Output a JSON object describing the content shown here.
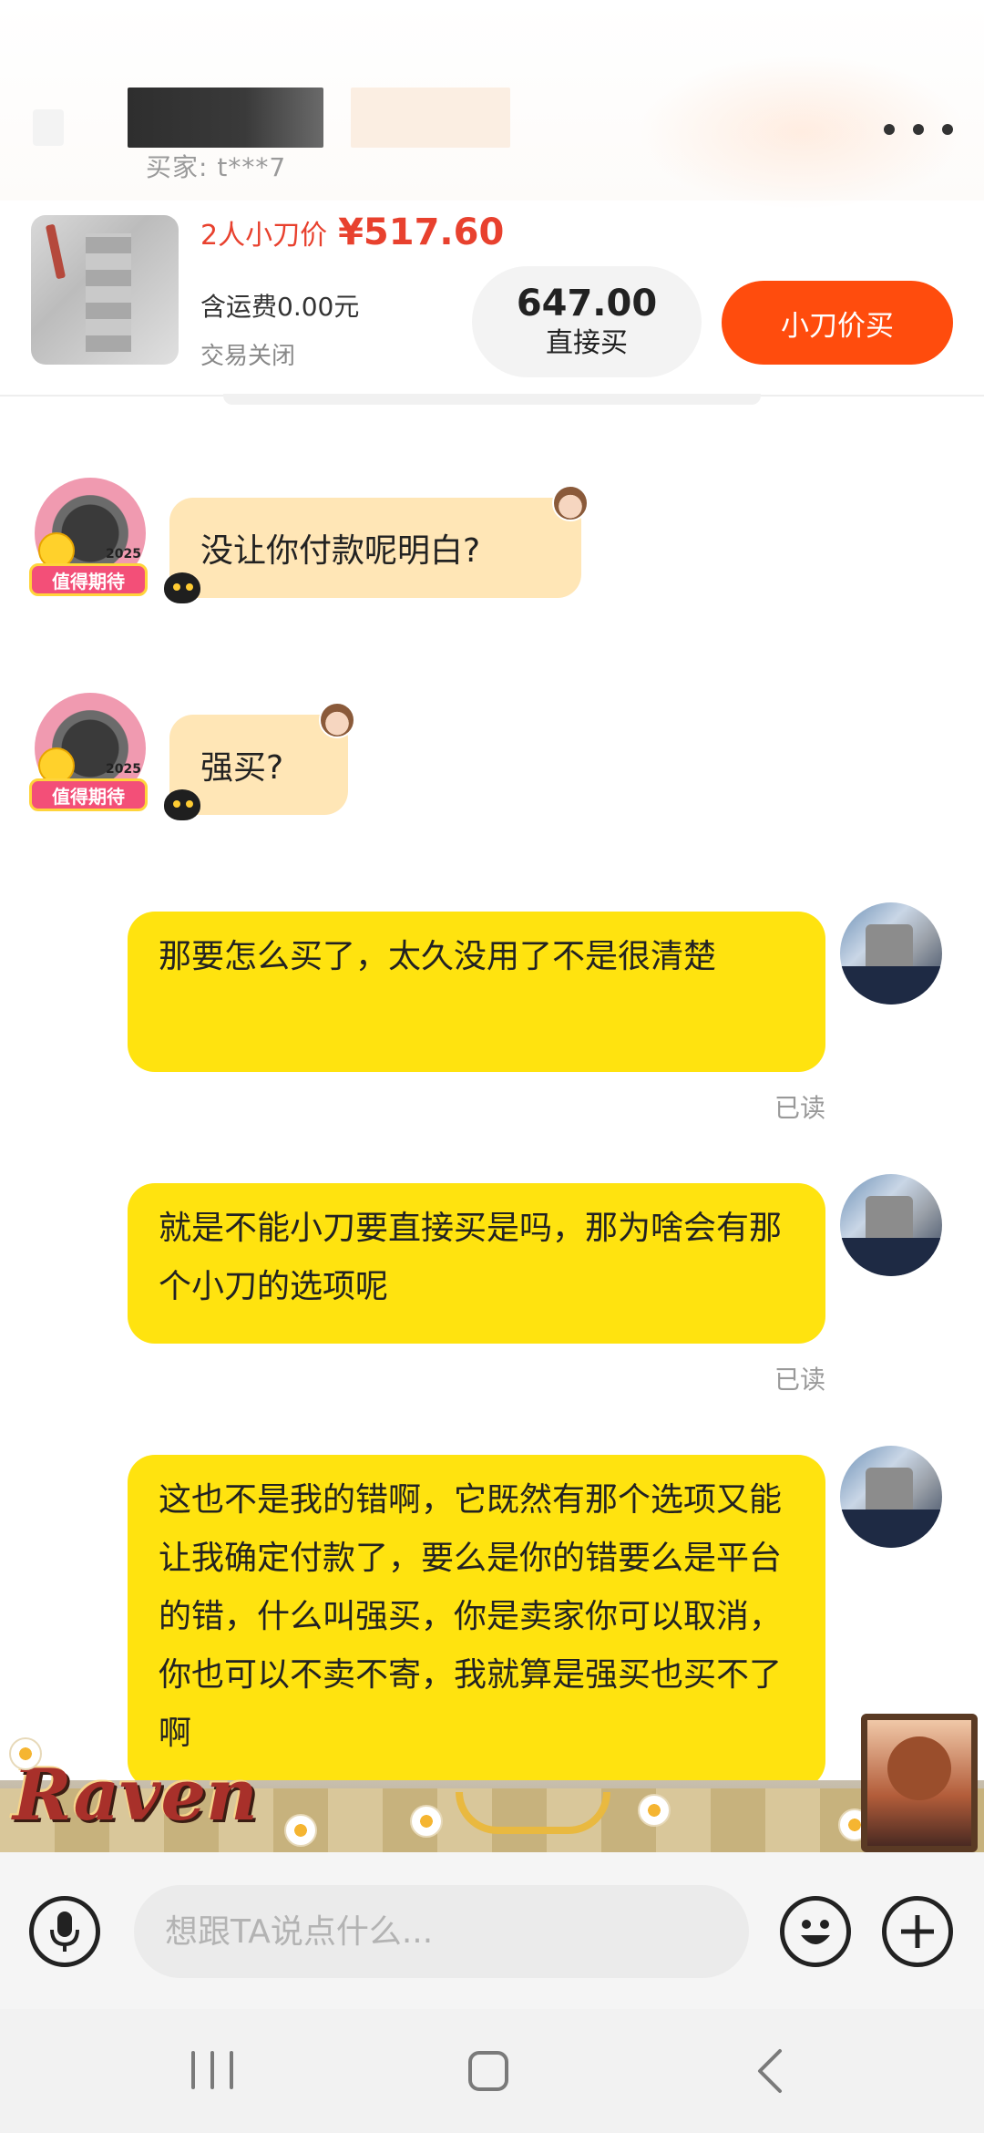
{
  "header": {
    "buyer_label": "买家: t***7",
    "more_icon": "more-dots-icon"
  },
  "product": {
    "price_tag": "2人小刀价",
    "price_value": "¥517.60",
    "shipping": "含运费0.00元",
    "status": "交易关闭",
    "direct_price": "647.00",
    "direct_label": "直接买",
    "cut_button": "小刀价买"
  },
  "messages": [
    {
      "from": "seller",
      "text": "没让你付款呢明白?"
    },
    {
      "from": "seller",
      "text": "强买?"
    },
    {
      "from": "self",
      "text": "那要怎么买了，太久没用了不是很清楚",
      "status": "已读"
    },
    {
      "from": "self",
      "text": "就是不能小刀要直接买是吗，那为啥会有那个小刀的选项呢",
      "status": "已读"
    },
    {
      "from": "self",
      "text": "这也不是我的错啊，它既然有那个选项又能让我确定付款了，要么是你的错要么是平台的错，什么叫强买，你是卖家你可以取消，你也可以不卖不寄，我就算是强买也买不了啊"
    }
  ],
  "seller_avatar_badge": "值得期待",
  "seller_avatar_year": "2025",
  "banner_text": "Raven",
  "input": {
    "placeholder": "想跟TA说点什么...",
    "mic_icon": "microphone-icon",
    "emoji_icon": "emoji-icon",
    "plus_icon": "plus-icon"
  },
  "colors": {
    "accent": "#ff4c0d",
    "price": "#e8412e",
    "self_bubble": "#ffe30f",
    "seller_bubble": "#ffe6b6"
  }
}
